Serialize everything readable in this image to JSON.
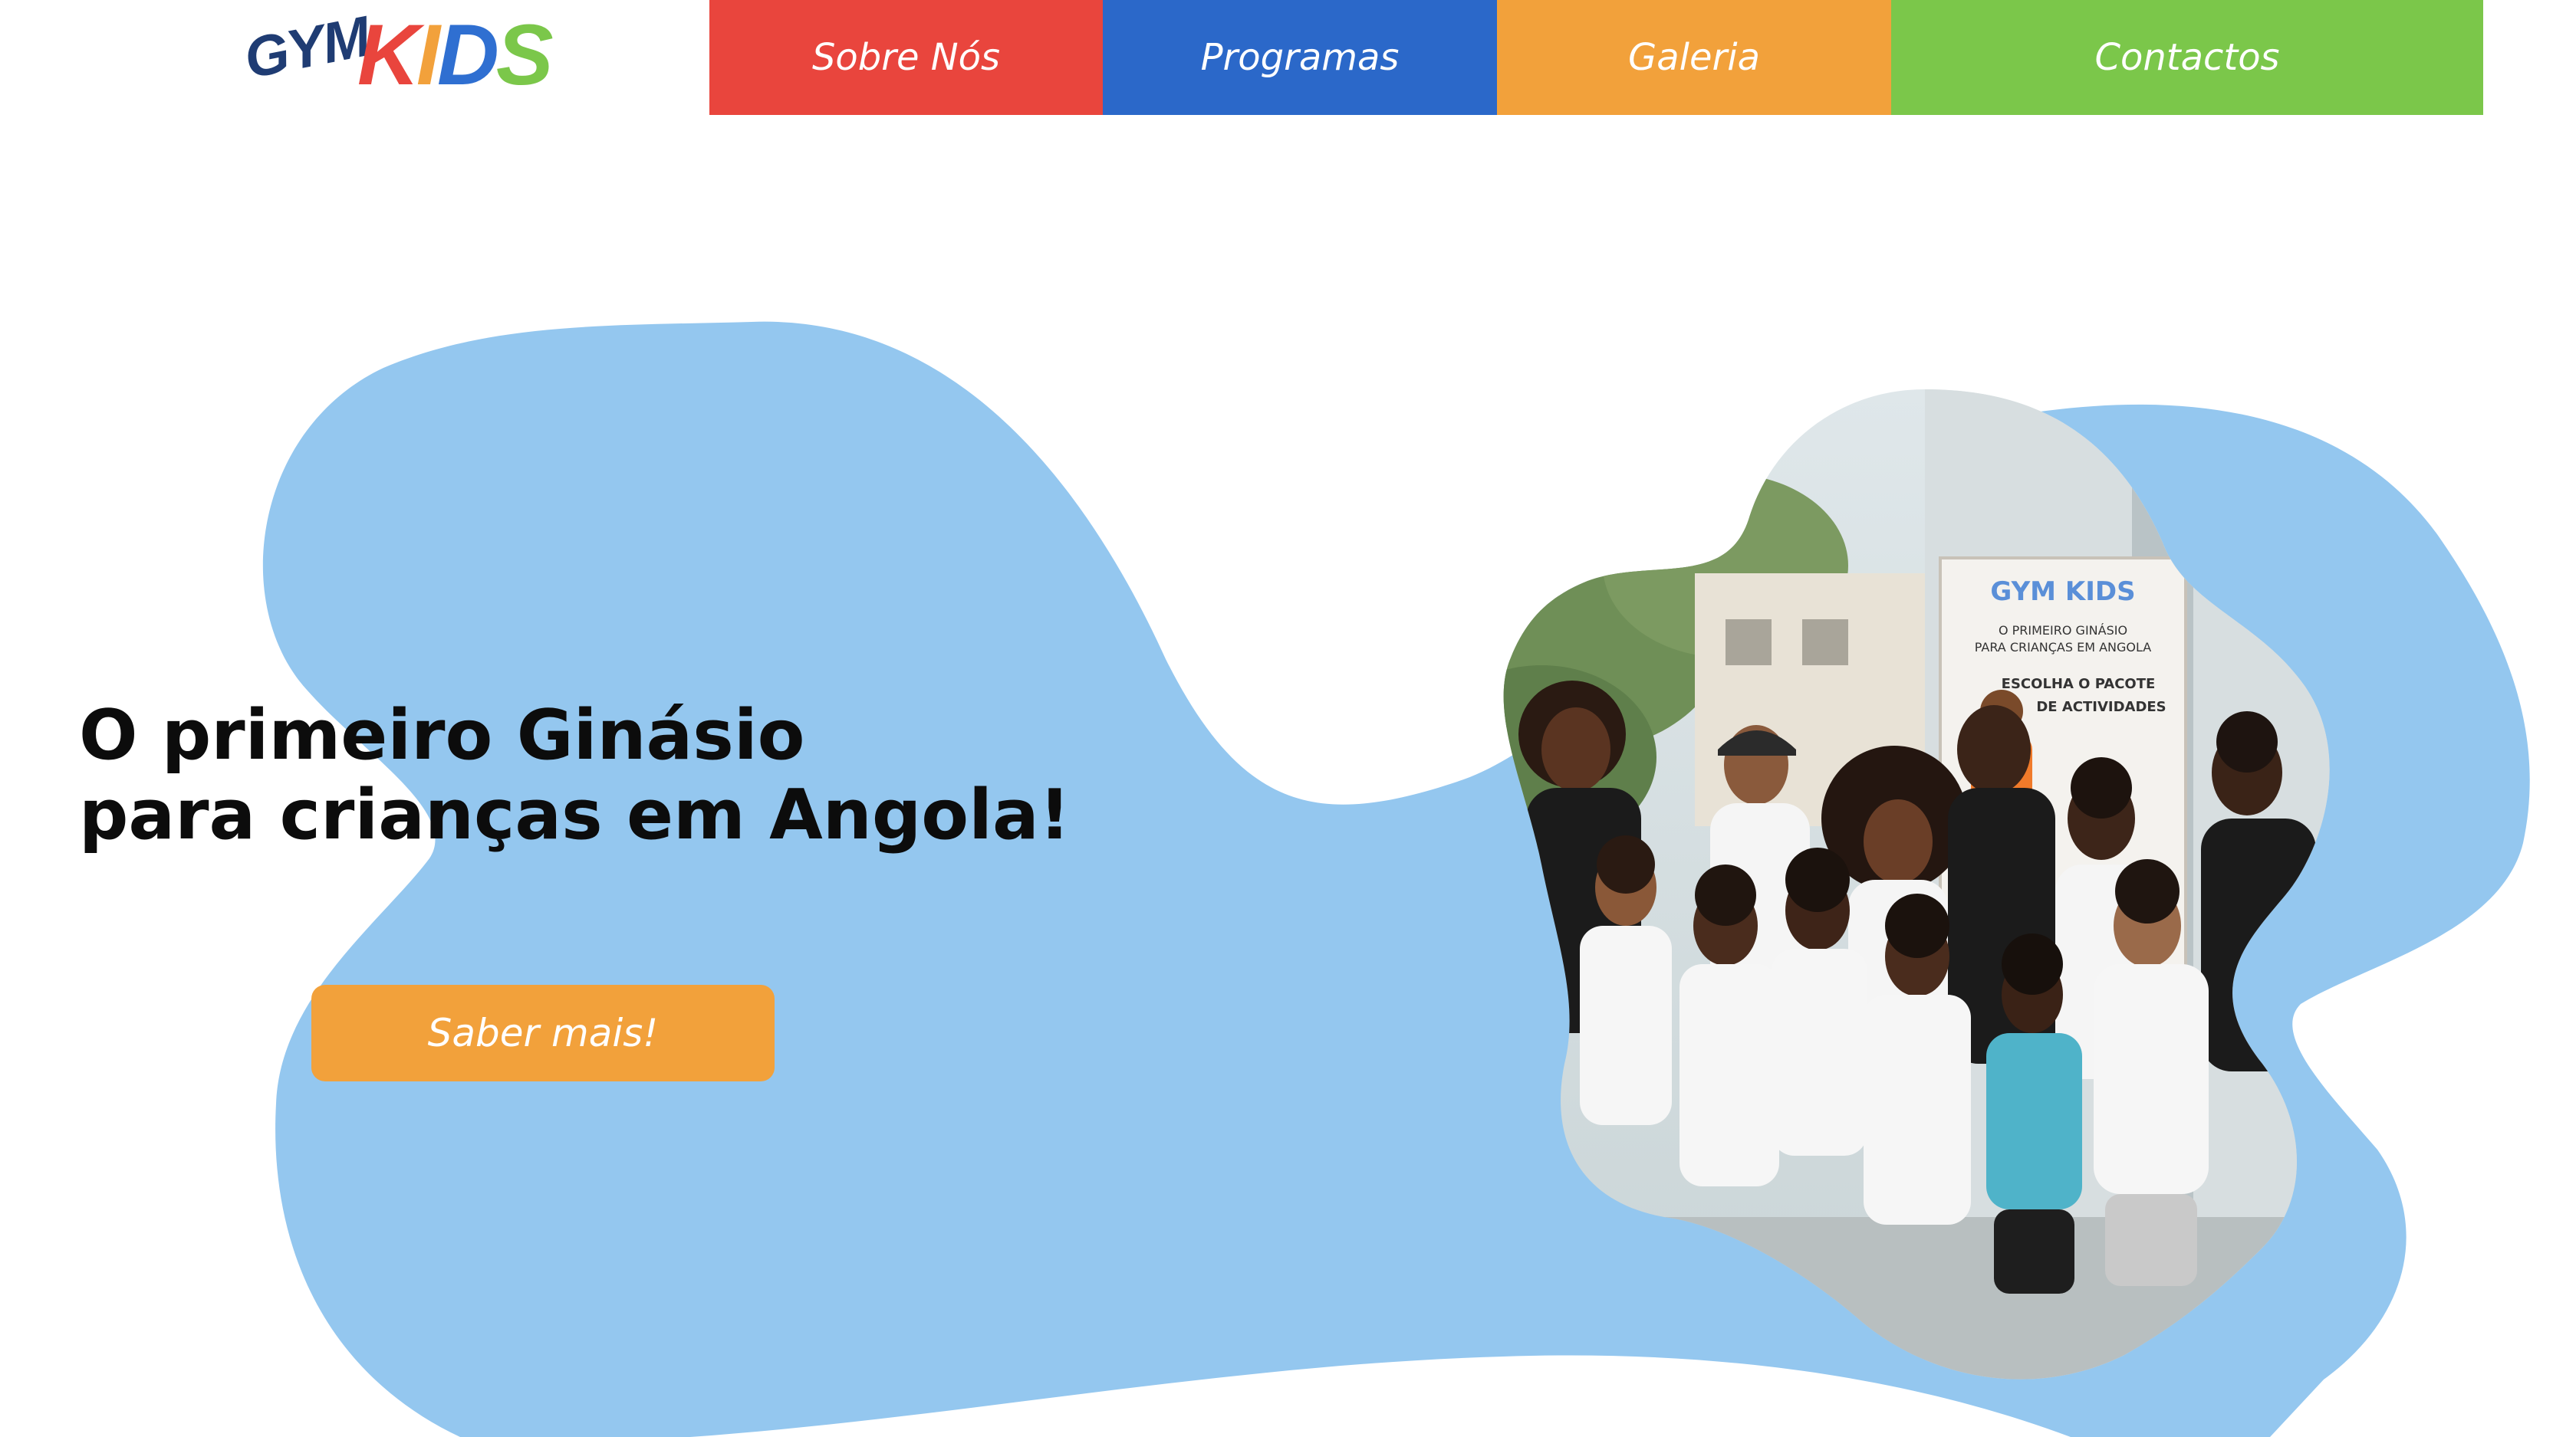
{
  "header": {
    "logo": {
      "gym": "GYM",
      "kids": [
        "K",
        "I",
        "D",
        "S"
      ]
    },
    "nav": [
      {
        "label": "Sobre Nós",
        "color": "#e9453d"
      },
      {
        "label": "Programas",
        "color": "#2b68c9"
      },
      {
        "label": "Galeria",
        "color": "#f2a13b"
      },
      {
        "label": "Contactos",
        "color": "#7bc74a"
      }
    ]
  },
  "hero": {
    "title_line1": "O primeiro Ginásio",
    "title_line2": "para crianças em Angola!",
    "cta_label": "Saber mais!",
    "blob_color": "#94c7ef",
    "cta_color": "#f2a13b"
  },
  "photo": {
    "poster_brand": "GYM KIDS",
    "poster_line1": "O PRIMEIRO GINÁSIO",
    "poster_line2": "PARA CRIANÇAS EM ANGOLA",
    "poster_line3": "ESCOLHA O PACOTE",
    "poster_line4": "DE ACTIVIDADES"
  }
}
